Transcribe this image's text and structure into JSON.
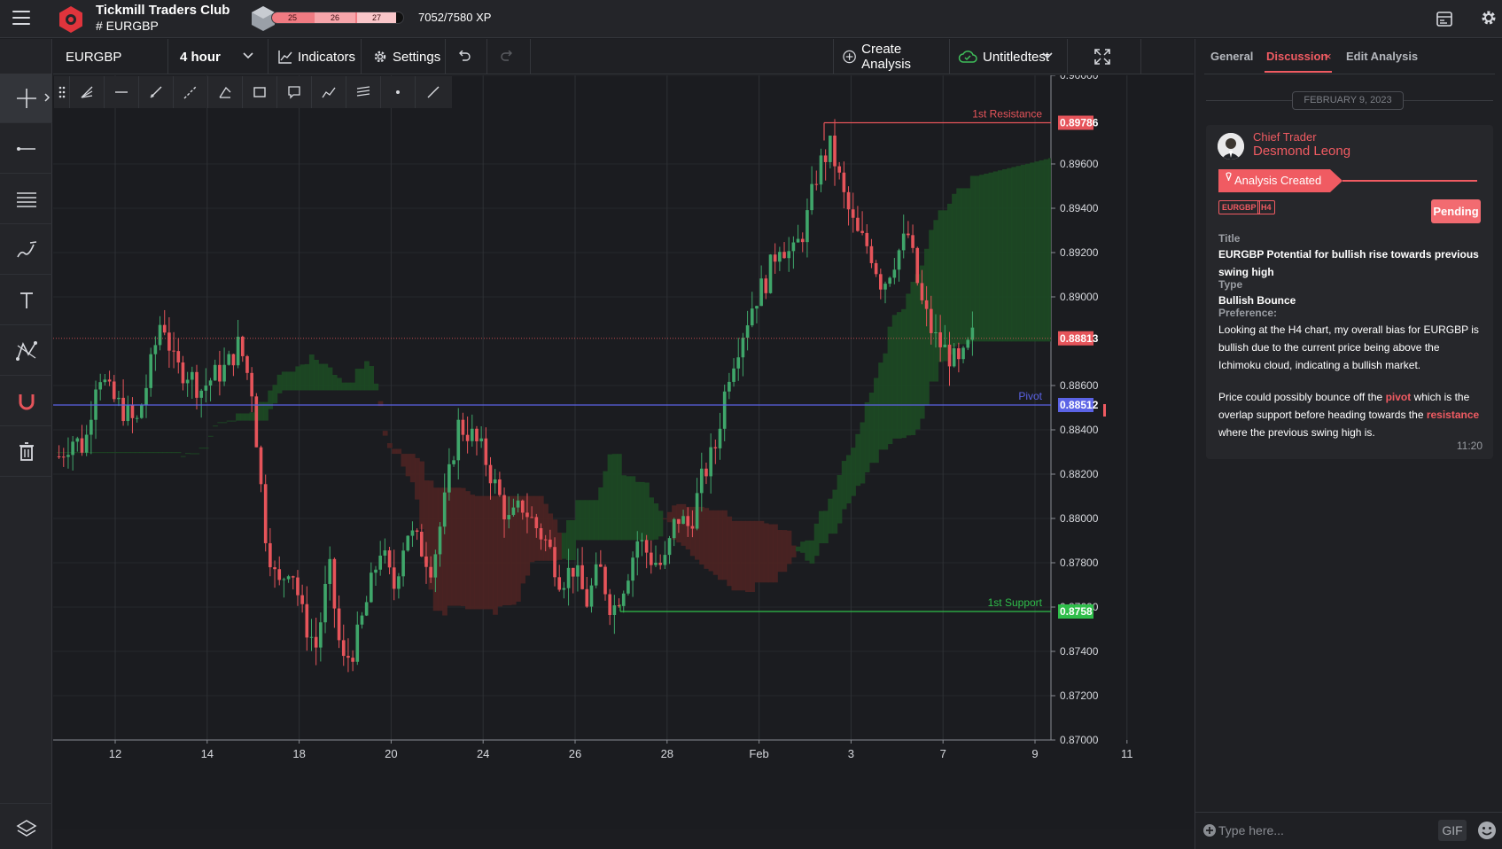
{
  "header": {
    "club_title": "Tickmill Traders Club",
    "channel": "# EURGBP",
    "xp_segments": [
      "25",
      "26",
      "27"
    ],
    "xp_progress": 0.93,
    "xp_text": "7052/7580 XP"
  },
  "chart_toolbar": {
    "symbol": "EURGBP",
    "interval": "4 hour",
    "indicators_label": "Indicators",
    "settings_label": "Settings",
    "create_analysis_label": "Create Analysis",
    "layout_name": "Untitledtest"
  },
  "colors": {
    "accent": "#f05b62",
    "bull": "#3fa66a",
    "bear": "#e6545a",
    "resistance": "#e6545a",
    "support": "#2fbe4a",
    "pivot": "#5b63e6",
    "cloud_green": "#1d4a24",
    "cloud_red": "#4c2422"
  },
  "chart_data": {
    "type": "candlestick",
    "symbol": "EURGBP",
    "timeframe": "4 hour",
    "ylim": [
      0.87,
      0.9
    ],
    "y_ticks": [
      "0.90000",
      "0.89600",
      "0.89400",
      "0.89200",
      "0.89000",
      "0.88600",
      "0.88400",
      "0.88200",
      "0.88000",
      "0.87800",
      "0.87600",
      "0.87400",
      "0.87200",
      "0.87000"
    ],
    "x_ticks": [
      "12",
      "14",
      "18",
      "20",
      "24",
      "26",
      "28",
      "Feb",
      "3",
      "7",
      "9",
      "11"
    ],
    "levels": [
      {
        "name": "1st Resistance",
        "value": 0.89786,
        "badge": "0.89786"
      },
      {
        "name": "Pivot",
        "value": 0.88512,
        "badge": "0.88512"
      },
      {
        "name": "1st Support",
        "value": 0.8758,
        "badge": "0.8758"
      }
    ],
    "last_price": {
      "value": 0.88813,
      "badge": "0.88813"
    },
    "close_path": [
      0.8828,
      0.8836,
      0.8832,
      0.8868,
      0.8855,
      0.8849,
      0.8842,
      0.8865,
      0.8892,
      0.8868,
      0.8866,
      0.8858,
      0.8864,
      0.8868,
      0.8879,
      0.8858,
      0.8795,
      0.8768,
      0.8781,
      0.8754,
      0.8742,
      0.8778,
      0.8734,
      0.8742,
      0.8764,
      0.8787,
      0.8768,
      0.8795,
      0.8788,
      0.8778,
      0.8808,
      0.8842,
      0.8838,
      0.8829,
      0.8813,
      0.8798,
      0.8806,
      0.8797,
      0.8788,
      0.8772,
      0.8778,
      0.8762,
      0.8778,
      0.8758,
      0.8772,
      0.8791,
      0.8782,
      0.8778,
      0.8801,
      0.8796,
      0.8818,
      0.8832,
      0.8865,
      0.8882,
      0.8898,
      0.8908,
      0.8925,
      0.8918,
      0.8932,
      0.8958,
      0.8968,
      0.8945,
      0.8928,
      0.8922,
      0.8905,
      0.8918,
      0.8928,
      0.8898,
      0.8882,
      0.8875,
      0.8868,
      0.8882
    ]
  },
  "right_panel": {
    "tabs": [
      "General",
      "Discussion",
      "Edit Analysis"
    ],
    "active_tab": "Discussion",
    "date_divider": "FEBRUARY 9, 2023",
    "message": {
      "role": "Chief Trader",
      "sender": "Desmond Leong",
      "banner": "Analysis Created",
      "tags": [
        "EURGBP",
        "H4"
      ],
      "status": "Pending",
      "title_label": "Title",
      "title": "EURGBP Potential for bullish rise towards previous swing high",
      "type_label": "Type",
      "type": "Bullish Bounce",
      "preference_label": "Preference:",
      "paragraph1": "Looking at the H4 chart, my overall bias for EURGBP is bullish due to the current price being above the Ichimoku cloud, indicating a bullish market.",
      "p2_a": "Price could possibly bounce off the ",
      "p2_pivot": "pivot",
      "p2_b": " which is the overlap support before heading towards the ",
      "p2_resistance": "resistance",
      "p2_c": " where the previous swing high is.",
      "time": "11:20"
    },
    "composer": {
      "placeholder": "Type here...",
      "gif_label": "GIF"
    }
  }
}
